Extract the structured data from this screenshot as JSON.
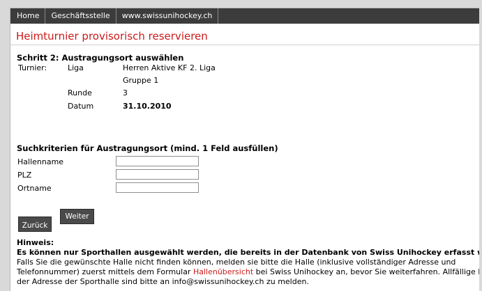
{
  "nav": {
    "items": [
      "Home",
      "Geschäftsstelle",
      "www.swissunihockey.ch"
    ]
  },
  "page": {
    "title": "Heimturnier provisorisch reservieren"
  },
  "step": {
    "heading": "Schritt 2: Austragungsort auswählen",
    "turnier_label": "Turnier:",
    "liga_label": "Liga",
    "liga_value_1": "Herren Aktive KF 2. Liga",
    "liga_value_2": "Gruppe 1",
    "runde_label": "Runde",
    "runde_value": "3",
    "datum_label": "Datum",
    "datum_value": "31.10.2010"
  },
  "search": {
    "heading": "Suchkriterien für Austragungsort (mind. 1 Feld ausfüllen)",
    "hallenname_label": "Hallenname",
    "hallenname_value": "",
    "plz_label": "PLZ",
    "plz_value": "",
    "ortname_label": "Ortname",
    "ortname_value": ""
  },
  "buttons": {
    "back_label": "Zurück",
    "next_label": "Weiter"
  },
  "hint": {
    "title": "Hinweis:",
    "bold_text": "Es können nur Sporthallen ausgewählt werden, die bereits in der Datenbank von Swiss Unihockey erfasst wurden.",
    "line1": "Falls Sie die gewünschte Halle nicht finden können, melden sie bitte die Halle (inklusive vollständiger Adresse und",
    "line2_before": "Telefonnummer) zuerst mittels dem Formular ",
    "line2_link": "Hallenübersicht",
    "line2_after": " bei Swiss Unihockey an, bevor Sie weiterfahren. Allfällige Fehler in",
    "line3": "der Adresse der Sporthalle sind bitte an info@swissunihockey.ch zu melden."
  }
}
